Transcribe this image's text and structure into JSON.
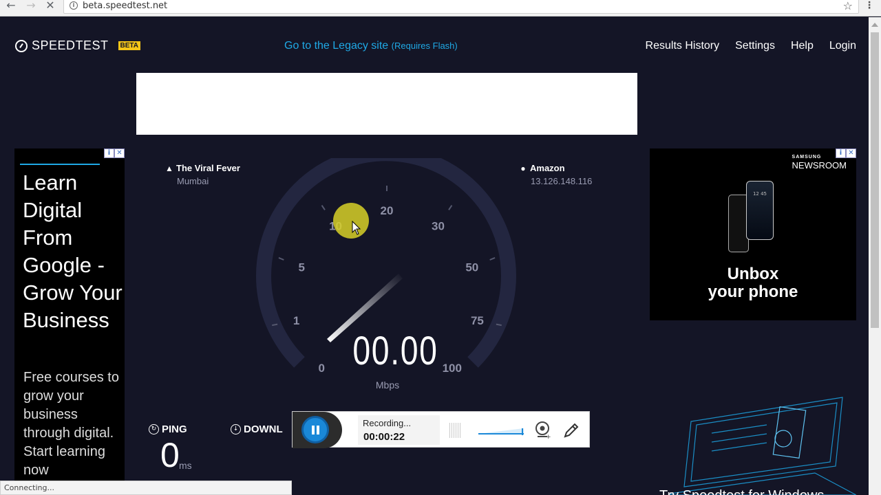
{
  "browser": {
    "url": "beta.speedtest.net",
    "status_text": "Connecting..."
  },
  "header": {
    "logo_text": "SPEEDTEST",
    "beta_badge": "BETA",
    "legacy_link": "Go to the Legacy site",
    "legacy_note": "(Requires Flash)",
    "nav": [
      "Results History",
      "Settings",
      "Help",
      "Login"
    ]
  },
  "servers": {
    "isp_name": "The Viral Fever",
    "isp_location": "Mumbai",
    "host_name": "Amazon",
    "host_ip": "13.126.148.116"
  },
  "gauge": {
    "ticks": [
      "0",
      "1",
      "5",
      "10",
      "20",
      "30",
      "50",
      "75",
      "100"
    ],
    "speed": "00.00",
    "unit": "Mbps"
  },
  "metrics": {
    "ping_label": "PING",
    "ping_value": "0",
    "ping_unit": "ms",
    "download_label": "DOWNL"
  },
  "left_ad": {
    "headline": "Learn Digital From Google - Grow Your Business",
    "body": "Free courses to grow your business through digital. Start learning now"
  },
  "right_ad": {
    "brand_top": "SAMSUNG",
    "brand_bottom": "NEWSROOM",
    "tagline_1": "Unbox",
    "tagline_2": "your phone",
    "phone_time": "12 45"
  },
  "laptop_ad": {
    "caption": "Try Speedtest for Windows"
  },
  "recorder": {
    "status": "Recording...",
    "timer": "00:00:22"
  },
  "colors": {
    "page_bg": "#141526",
    "accent": "#1fa9e6",
    "beta": "#f5c518"
  }
}
